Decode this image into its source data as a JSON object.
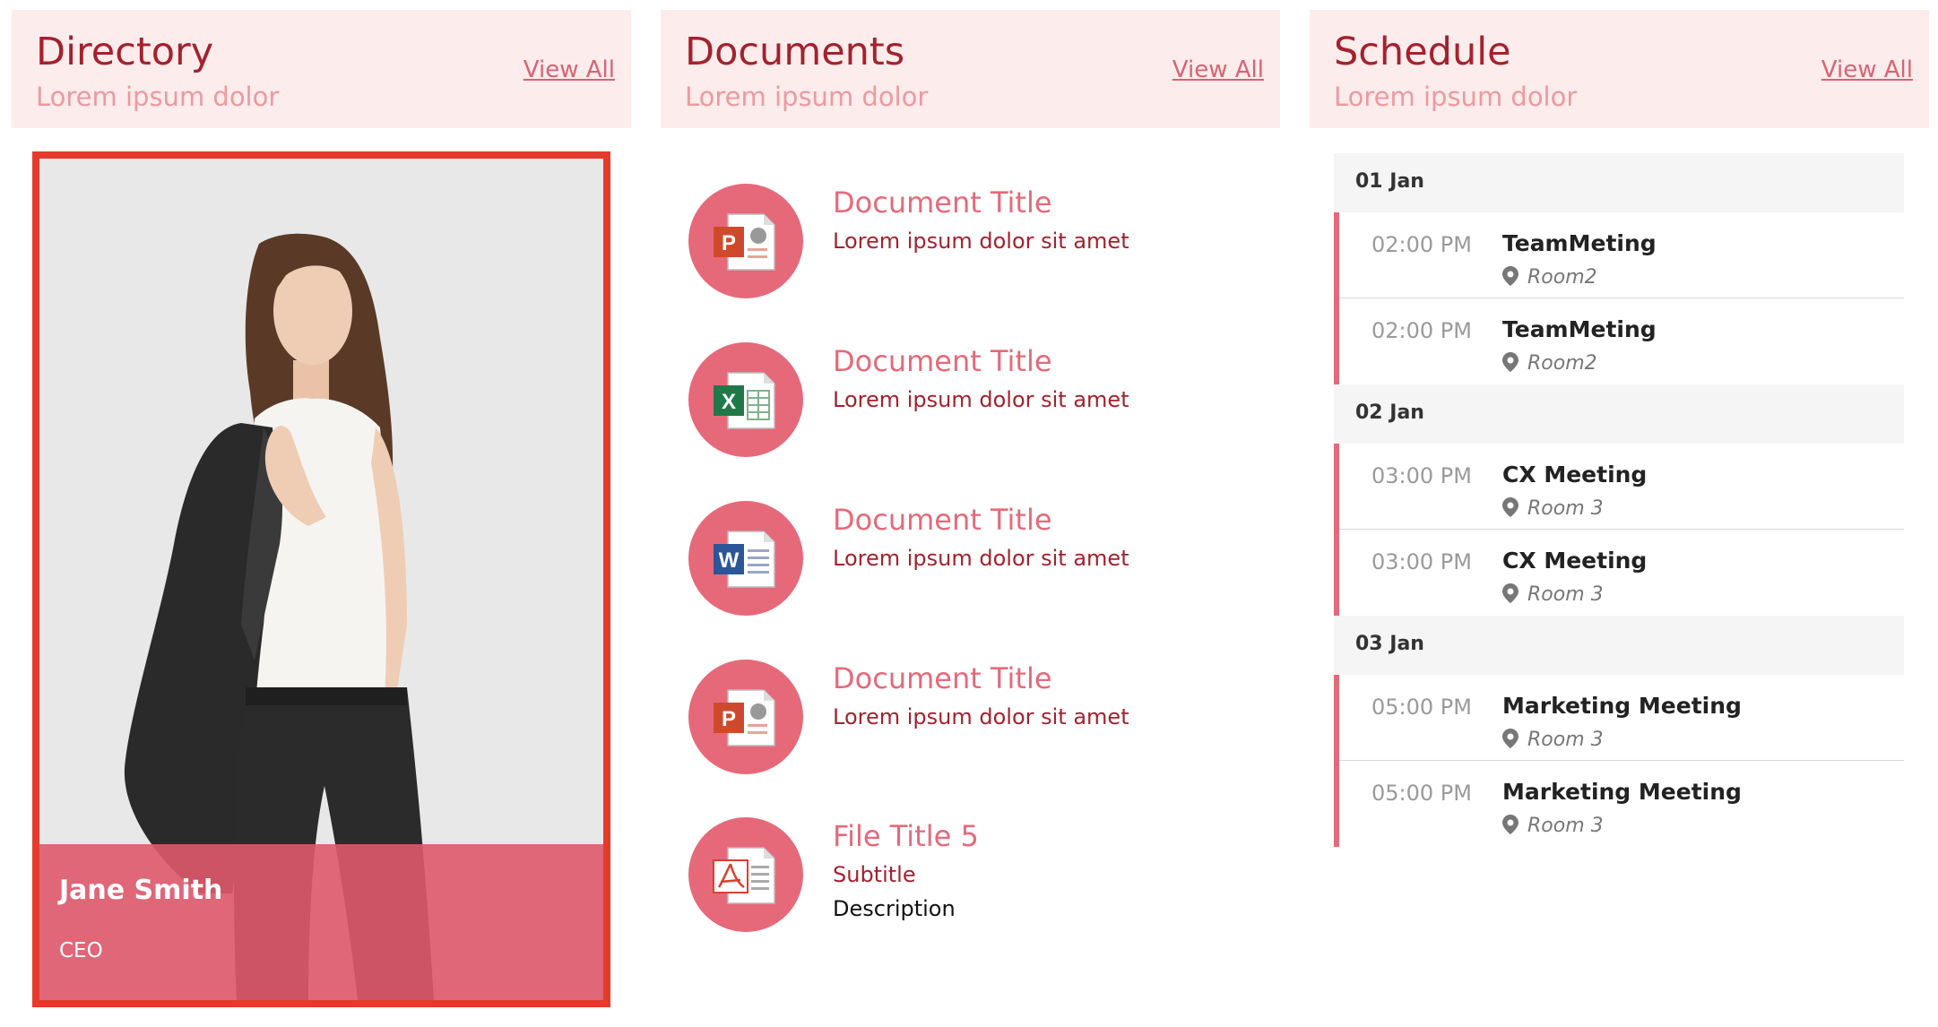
{
  "directory": {
    "title": "Directory",
    "subtitle": "Lorem ipsum dolor",
    "view_all": "View All",
    "person": {
      "name": "Jane Smith",
      "role": "CEO",
      "photo_icon": "person-photo"
    }
  },
  "documents": {
    "title": "Documents",
    "subtitle": "Lorem ipsum dolor",
    "view_all": "View All",
    "items": [
      {
        "title": "Document Title",
        "subtitle": "Lorem ipsum dolor sit amet",
        "icon": "powerpoint-icon"
      },
      {
        "title": "Document Title",
        "subtitle": "Lorem ipsum dolor sit amet",
        "icon": "excel-icon"
      },
      {
        "title": "Document Title",
        "subtitle": "Lorem ipsum dolor sit amet",
        "icon": "word-icon"
      },
      {
        "title": "Document Title",
        "subtitle": "Lorem ipsum dolor sit amet",
        "icon": "powerpoint-icon"
      },
      {
        "title": "File Title 5",
        "subtitle": "Subtitle",
        "description": "Description",
        "icon": "pdf-icon"
      }
    ]
  },
  "schedule": {
    "title": "Schedule",
    "subtitle": "Lorem ipsum dolor",
    "view_all": "View All",
    "days": [
      {
        "date": "01 Jan",
        "events": [
          {
            "time": "02:00 PM",
            "name": "TeamMeting",
            "room": "Room2"
          },
          {
            "time": "02:00 PM",
            "name": "TeamMeting",
            "room": "Room2"
          }
        ]
      },
      {
        "date": "02 Jan",
        "events": [
          {
            "time": "03:00 PM",
            "name": "CX Meeting",
            "room": "Room 3"
          },
          {
            "time": "03:00 PM",
            "name": "CX Meeting",
            "room": "Room 3"
          }
        ]
      },
      {
        "date": "03 Jan",
        "events": [
          {
            "time": "05:00 PM",
            "name": "Marketing Meeting",
            "room": "Room 3"
          },
          {
            "time": "05:00 PM",
            "name": "Marketing Meeting",
            "room": "Room 3"
          }
        ]
      }
    ]
  },
  "colors": {
    "accent": "#e6697a",
    "header_bg": "#fcecec",
    "title": "#a3222e",
    "card_border": "#e53a2c"
  }
}
